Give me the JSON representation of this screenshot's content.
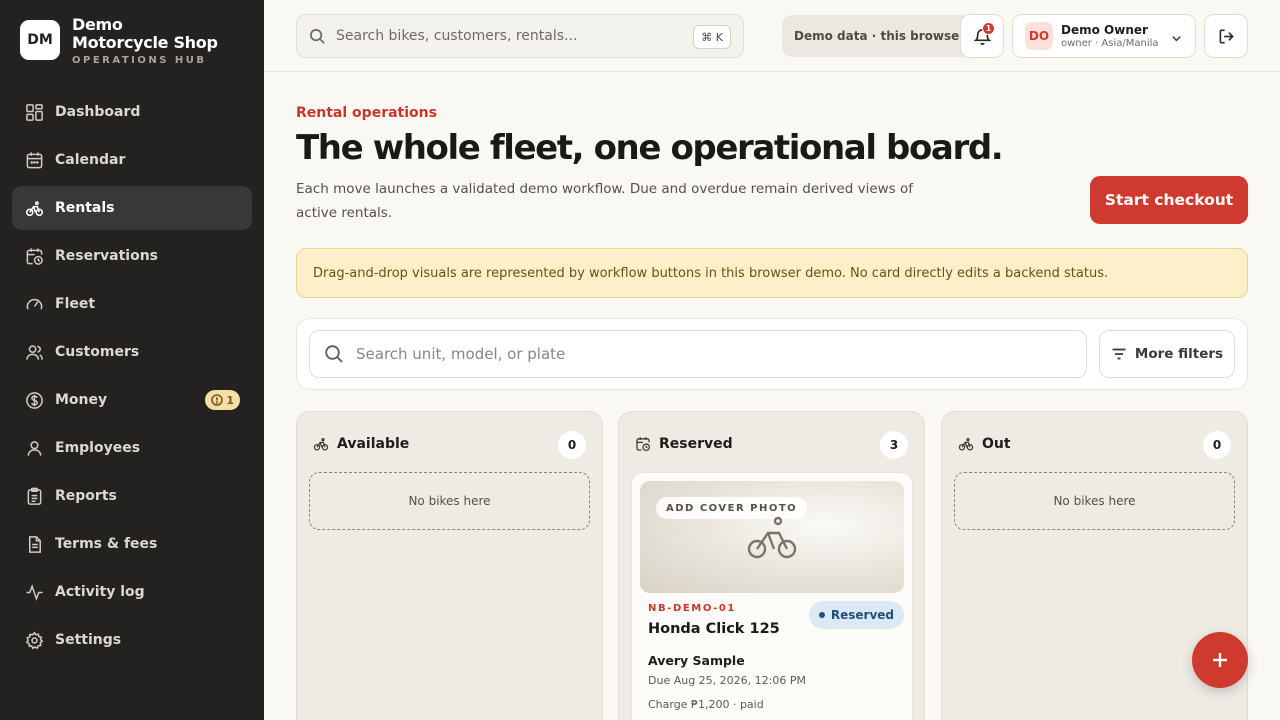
{
  "brand": {
    "initials": "DM",
    "name": "Demo Motorcycle Shop",
    "subtitle": "OPERATIONS HUB"
  },
  "nav": {
    "items": [
      {
        "label": "Dashboard",
        "icon": "dashboard-icon"
      },
      {
        "label": "Calendar",
        "icon": "calendar-icon"
      },
      {
        "label": "Rentals",
        "icon": "bike-icon",
        "active": true
      },
      {
        "label": "Reservations",
        "icon": "calendar-clock-icon"
      },
      {
        "label": "Fleet",
        "icon": "gauge-icon"
      },
      {
        "label": "Customers",
        "icon": "users-icon"
      },
      {
        "label": "Money",
        "icon": "dollar-icon",
        "badge": "1"
      },
      {
        "label": "Employees",
        "icon": "user-icon"
      },
      {
        "label": "Reports",
        "icon": "clipboard-icon"
      },
      {
        "label": "Terms & fees",
        "icon": "document-icon"
      },
      {
        "label": "Activity log",
        "icon": "activity-icon"
      },
      {
        "label": "Settings",
        "icon": "gear-icon"
      }
    ]
  },
  "topbar": {
    "search_placeholder": "Search bikes, customers, rentals...",
    "shortcut": "⌘ K",
    "demo_label": "Demo data · this browser",
    "notifications": "1",
    "user": {
      "initials": "DO",
      "name": "Demo Owner",
      "role": "owner · Asia/Manila"
    }
  },
  "main": {
    "eyebrow": "Rental operations",
    "title": "The whole fleet, one operational board.",
    "description": "Each move launches a validated demo workflow. Due and overdue remain derived views of active rentals.",
    "cta": "Start checkout",
    "notice": "Drag-and-drop visuals are represented by workflow buttons in this browser demo. No card directly edits a backend status.",
    "unit_search_placeholder": "Search unit, model, or plate",
    "more_filters": "More filters"
  },
  "board": {
    "columns": [
      {
        "title": "Available",
        "count": "0",
        "empty": "No bikes here"
      },
      {
        "title": "Reserved",
        "count": "3",
        "cards": [
          {
            "cover_tag": "ADD COVER PHOTO",
            "plate": "NB-DEMO-01",
            "model": "Honda Click 125",
            "status": "Reserved",
            "customer": "Avery Sample",
            "due": "Due Aug 25, 2026, 12:06 PM",
            "charge": "Charge ₱1,200 · paid"
          }
        ]
      },
      {
        "title": "Out",
        "count": "0",
        "empty": "No bikes here"
      }
    ]
  },
  "colors": {
    "accent": "#cf3a2e",
    "sidebar": "#232221",
    "notice_bg": "#fcefc9",
    "status_bg": "#dbe9f5"
  }
}
